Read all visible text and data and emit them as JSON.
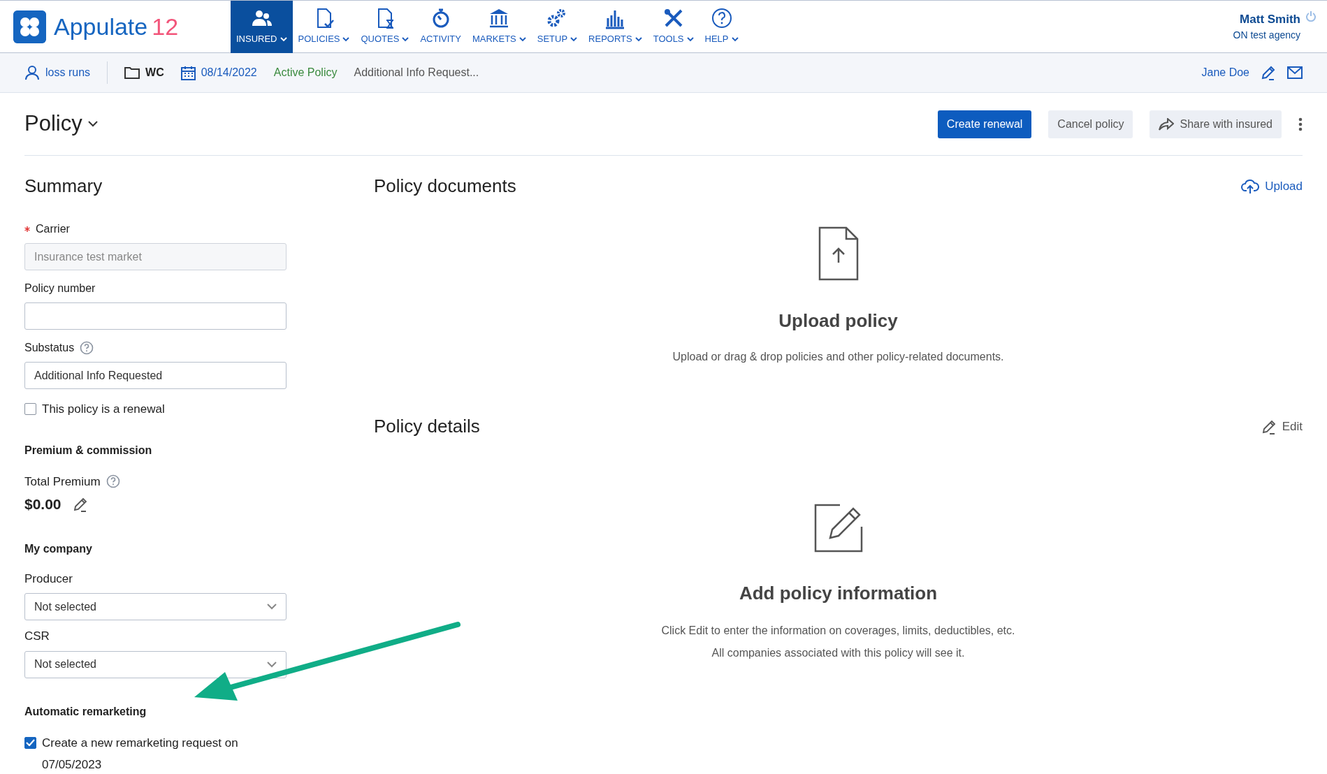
{
  "app": {
    "logo_text": "Appulate",
    "logo_version": "12"
  },
  "nav": [
    {
      "label": "INSURED",
      "caret": true,
      "selected": true
    },
    {
      "label": "POLICIES",
      "caret": true,
      "selected": false
    },
    {
      "label": "QUOTES",
      "caret": true,
      "selected": false
    },
    {
      "label": "ACTIVITY",
      "caret": false,
      "selected": false
    },
    {
      "label": "MARKETS",
      "caret": true,
      "selected": false
    },
    {
      "label": "SETUP",
      "caret": true,
      "selected": false
    },
    {
      "label": "REPORTS",
      "caret": true,
      "selected": false
    },
    {
      "label": "TOOLS",
      "caret": true,
      "selected": false
    },
    {
      "label": "HELP",
      "caret": true,
      "selected": false
    }
  ],
  "user": {
    "name": "Matt Smith",
    "agency": "ON test agency"
  },
  "context_bar": {
    "insured": "loss runs",
    "line": "WC",
    "date": "08/14/2022",
    "status": "Active Policy",
    "substatus": "Additional Info Request...",
    "contact": "Jane Doe"
  },
  "page": {
    "title": "Policy",
    "actions": [
      {
        "label": "Create renewal",
        "kind": "primary"
      },
      {
        "label": "Cancel policy",
        "kind": "secondary"
      },
      {
        "label": "Share with insured",
        "kind": "share"
      }
    ]
  },
  "summary": {
    "title": "Summary",
    "fields": [
      {
        "label": "Carrier",
        "required": true,
        "value": "Insurance test market",
        "disabled": true,
        "help": false
      },
      {
        "label": "Policy number",
        "required": false,
        "disabled": false,
        "help": false
      },
      {
        "label": "Substatus",
        "required": false,
        "value": "Additional Info Requested",
        "disabled": false,
        "help": true
      }
    ],
    "renewal_checkbox": {
      "label": "This policy is a renewal",
      "checked": false
    },
    "premium": {
      "title": "Premium & commission",
      "label": "Total Premium",
      "value": "$0.00"
    },
    "company": {
      "title": "My company",
      "selects": [
        {
          "label": "Producer",
          "value": "Not selected"
        },
        {
          "label": "CSR",
          "value": "Not selected"
        }
      ]
    },
    "remarketing": {
      "title": "Automatic remarketing",
      "checked": true,
      "label": "Create a new remarketing request on",
      "date": "07/05/2023"
    }
  },
  "documents": {
    "title": "Policy documents",
    "action": "Upload",
    "empty_title": "Upload policy",
    "empty_lines": [
      "Upload or drag & drop policies and other policy-related documents."
    ]
  },
  "details": {
    "title": "Policy details",
    "action": "Edit",
    "empty_title": "Add policy information",
    "empty_lines": [
      "Click Edit to enter the information on coverages, limits, deductibles, etc.",
      "All companies associated with this policy will see it."
    ]
  }
}
